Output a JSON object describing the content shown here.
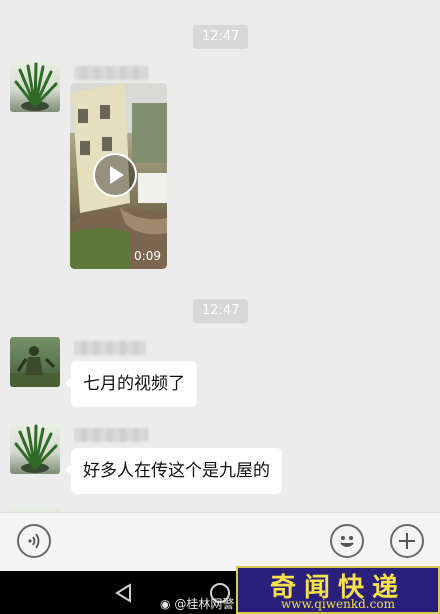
{
  "messages": {
    "timestamp_1": "12:47",
    "timestamp_2": "12:47",
    "video_duration": "0:09",
    "text_1": "七月的视频了",
    "text_2": "好多人在传这个是九屋的"
  },
  "watermark": {
    "source": "@桂林网警",
    "brand_cn": "奇闻快递",
    "brand_url": "www.qiwenkd.com"
  },
  "icons": {
    "voice": "voice-icon",
    "emoji": "emoji-icon",
    "plus": "plus-icon",
    "play": "play-icon",
    "back": "back-triangle-icon",
    "home": "home-circle-icon",
    "weibo": "weibo-icon"
  },
  "colors": {
    "chat_background": "#ececec",
    "bubble": "#ffffff",
    "timestamp_bg": "#d7d7d7",
    "nav_bar": "#000000",
    "watermark_bg": "#2a1f7a",
    "watermark_text": "#f5e24a"
  }
}
